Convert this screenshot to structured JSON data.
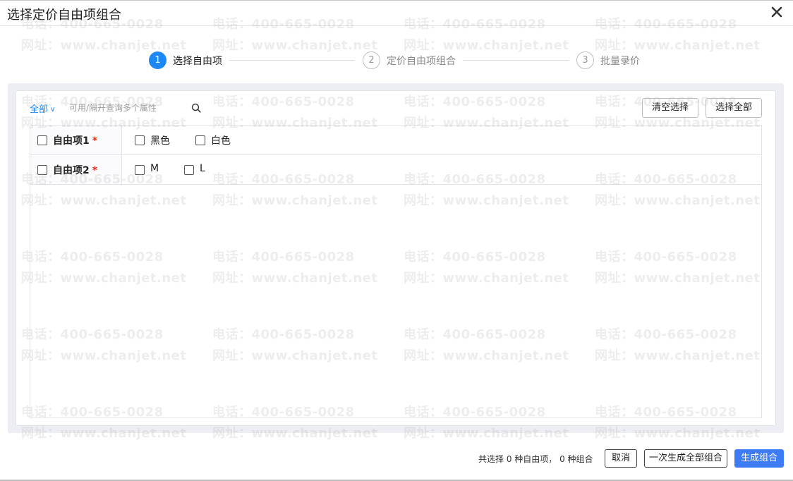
{
  "dialog": {
    "title": "选择定价自由项组合"
  },
  "steps": [
    {
      "number": "1",
      "label": "选择自由项",
      "active": true
    },
    {
      "number": "2",
      "label": "定价自由项组合",
      "active": false
    },
    {
      "number": "3",
      "label": "批量录价",
      "active": false
    }
  ],
  "filter": {
    "scope_label": "全部",
    "search_placeholder": "可用/隔开查询多个属性"
  },
  "toolbar": {
    "clear_label": "清空选择",
    "select_all_label": "选择全部"
  },
  "free_items": [
    {
      "name": "自由项1",
      "required_mark": "*",
      "options": [
        "黑色",
        "白色"
      ]
    },
    {
      "name": "自由项2",
      "required_mark": "*",
      "options": [
        "M",
        "L"
      ]
    }
  ],
  "footer": {
    "summary": "共选择 0 种自由项， 0 种组合",
    "cancel_label": "取消",
    "generate_all_label": "一次生成全部组合",
    "generate_label": "生成组合"
  },
  "watermark": {
    "phone": "电话：400-665-0028",
    "site": "网址：www.chanjet.net"
  },
  "colors": {
    "accent": "#1e88f5",
    "primary_button": "#3d7cf5",
    "required": "#e0301e"
  }
}
